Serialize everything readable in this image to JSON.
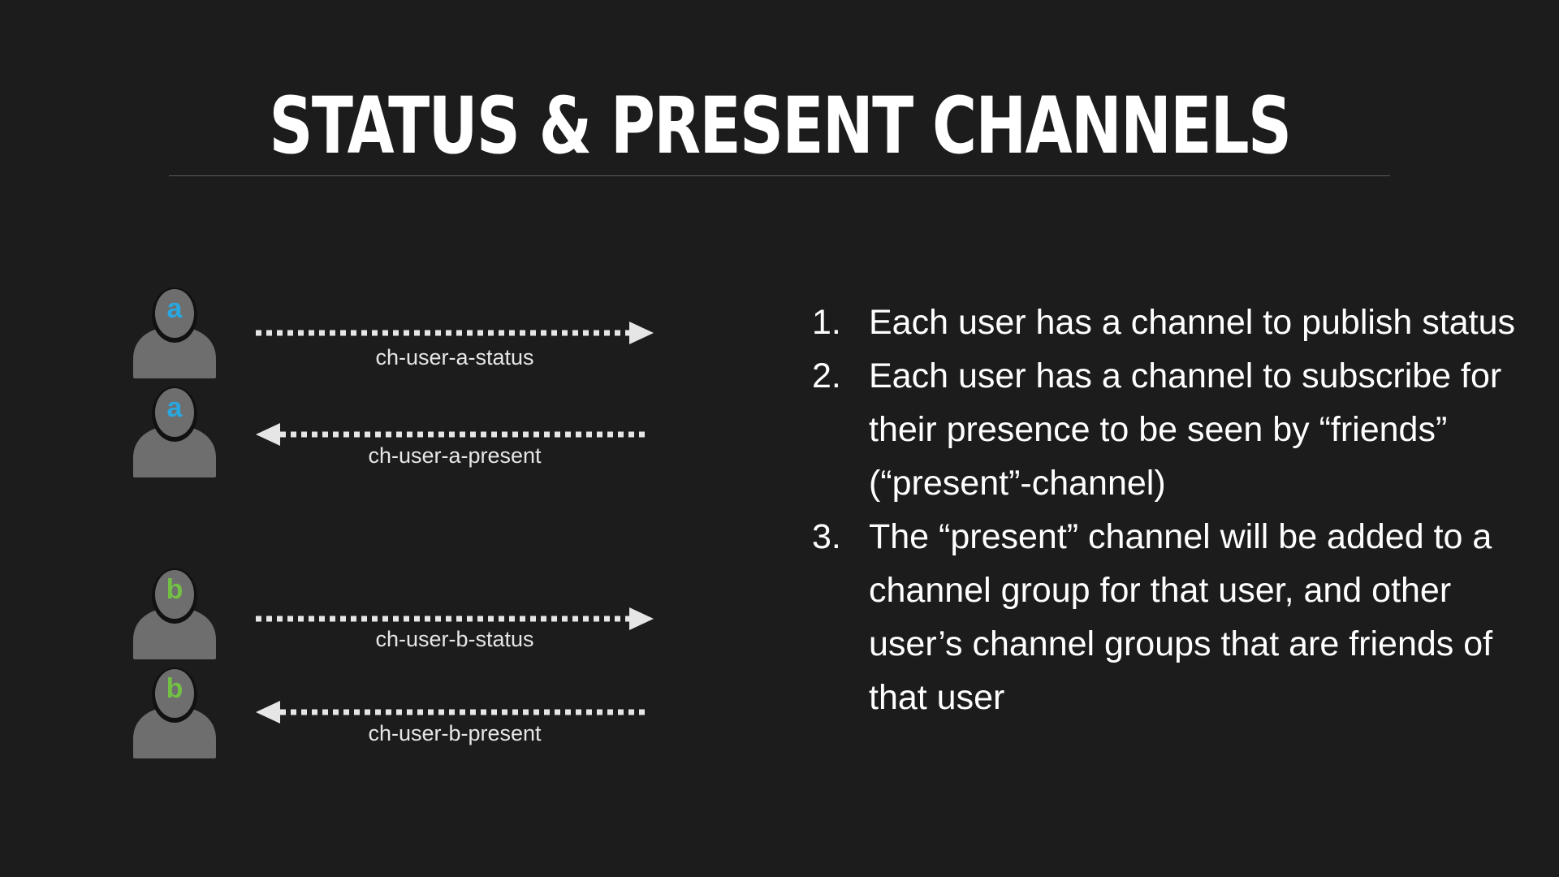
{
  "title": "STATUS & PRESENT CHANNELS",
  "colors": {
    "background": "#1c1c1c",
    "avatar": "#6e6e6e",
    "avatar_outline": "#111111",
    "user_a": "#29a8e0",
    "user_b": "#72c044",
    "arrow": "#e6e6e6"
  },
  "diagram": {
    "rows": [
      {
        "user": "a",
        "direction": "right",
        "channel": "ch-user-a-status"
      },
      {
        "user": "a",
        "direction": "left",
        "channel": "ch-user-a-present"
      },
      {
        "user": "b",
        "direction": "right",
        "channel": "ch-user-b-status"
      },
      {
        "user": "b",
        "direction": "left",
        "channel": "ch-user-b-present"
      }
    ]
  },
  "points": [
    {
      "num": "1.",
      "text": "Each user has a channel to publish status"
    },
    {
      "num": "2.",
      "text": "Each user has a channel to subscribe for their presence to be seen by “friends” (“present”-channel)"
    },
    {
      "num": "3.",
      "text": "The “present” channel will be added to a channel group for that user, and other user’s channel groups that are friends of that user"
    }
  ]
}
